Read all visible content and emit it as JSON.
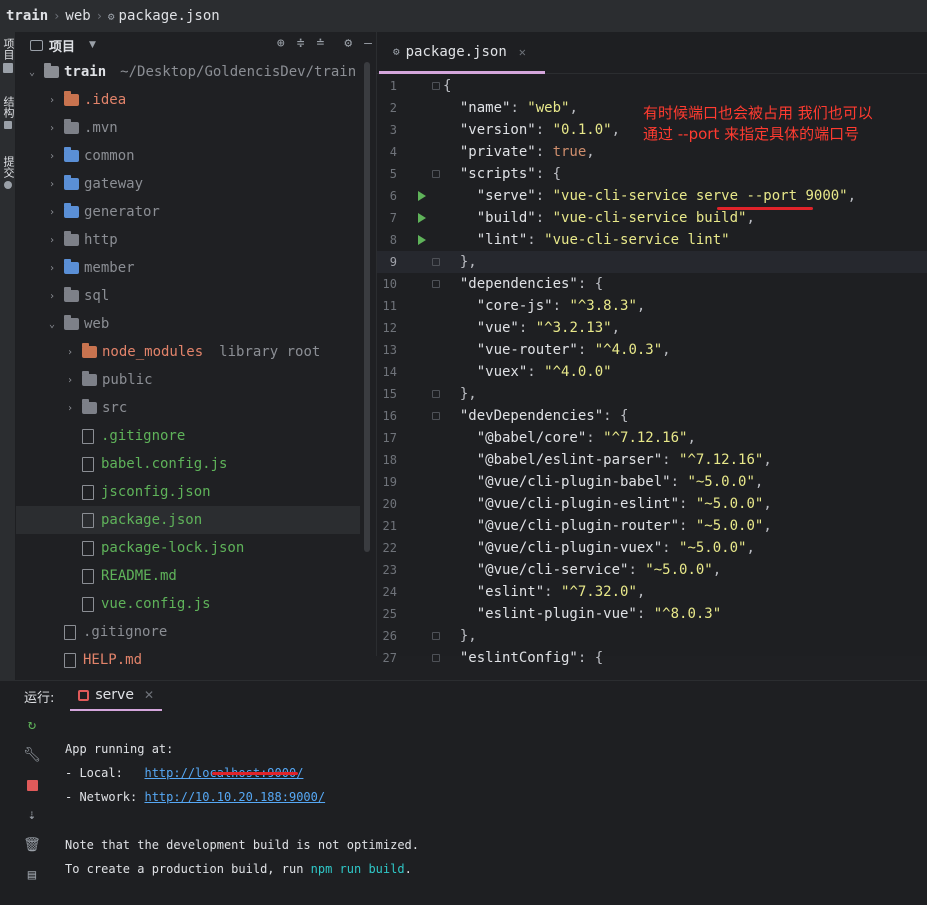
{
  "breadcrumb": {
    "items": [
      "train",
      "web"
    ],
    "file": "package.json"
  },
  "strip": {
    "project": "项目",
    "structure": "结构",
    "commit": "提交"
  },
  "project_panel": {
    "title": "项目",
    "root_name": "train",
    "root_path": "~/Desktop/GoldencisDev/train",
    "items": [
      {
        "label": ".idea",
        "type": "folder",
        "color": "#e2836a"
      },
      {
        "label": ".mvn",
        "type": "folder",
        "color": "#8b8e94"
      },
      {
        "label": "common",
        "type": "module",
        "color": "#8b8e94"
      },
      {
        "label": "gateway",
        "type": "module",
        "color": "#8b8e94"
      },
      {
        "label": "generator",
        "type": "module",
        "color": "#8b8e94"
      },
      {
        "label": "http",
        "type": "folder",
        "color": "#8b8e94"
      },
      {
        "label": "member",
        "type": "module",
        "color": "#8b8e94"
      },
      {
        "label": "sql",
        "type": "folder",
        "color": "#8b8e94"
      },
      {
        "label": "web",
        "type": "folder",
        "color": "#8b8e94"
      },
      {
        "label": "node_modules",
        "type": "folder",
        "color": "#e2836a",
        "suffix": "library root"
      },
      {
        "label": "public",
        "type": "folder",
        "color": "#8b8e94"
      },
      {
        "label": "src",
        "type": "folder",
        "color": "#8b8e94"
      },
      {
        "label": ".gitignore",
        "type": "file",
        "color": "#5fb35a"
      },
      {
        "label": "babel.config.js",
        "type": "file",
        "color": "#5fb35a"
      },
      {
        "label": "jsconfig.json",
        "type": "file",
        "color": "#5fb35a"
      },
      {
        "label": "package.json",
        "type": "file",
        "color": "#5fb35a"
      },
      {
        "label": "package-lock.json",
        "type": "file",
        "color": "#5fb35a"
      },
      {
        "label": "README.md",
        "type": "file",
        "color": "#5fb35a"
      },
      {
        "label": "vue.config.js",
        "type": "file",
        "color": "#5fb35a"
      },
      {
        "label": ".gitignore",
        "type": "file",
        "color": "#8b8e94"
      },
      {
        "label": "HELP.md",
        "type": "file",
        "color": "#e2836a"
      }
    ]
  },
  "editor": {
    "tab": "package.json",
    "lines": [
      {
        "n": "1",
        "t": "{"
      },
      {
        "n": "2",
        "t": "  \"name\": \"web\","
      },
      {
        "n": "3",
        "t": "  \"version\": \"0.1.0\","
      },
      {
        "n": "4",
        "t": "  \"private\": true,"
      },
      {
        "n": "5",
        "t": "  \"scripts\": {"
      },
      {
        "n": "6",
        "t": "    \"serve\": \"vue-cli-service serve --port 9000\","
      },
      {
        "n": "7",
        "t": "    \"build\": \"vue-cli-service build\","
      },
      {
        "n": "8",
        "t": "    \"lint\": \"vue-cli-service lint\""
      },
      {
        "n": "9",
        "t": "  },"
      },
      {
        "n": "10",
        "t": "  \"dependencies\": {"
      },
      {
        "n": "11",
        "t": "    \"core-js\": \"^3.8.3\","
      },
      {
        "n": "12",
        "t": "    \"vue\": \"^3.2.13\","
      },
      {
        "n": "13",
        "t": "    \"vue-router\": \"^4.0.3\","
      },
      {
        "n": "14",
        "t": "    \"vuex\": \"^4.0.0\""
      },
      {
        "n": "15",
        "t": "  },"
      },
      {
        "n": "16",
        "t": "  \"devDependencies\": {"
      },
      {
        "n": "17",
        "t": "    \"@babel/core\": \"^7.12.16\","
      },
      {
        "n": "18",
        "t": "    \"@babel/eslint-parser\": \"^7.12.16\","
      },
      {
        "n": "19",
        "t": "    \"@vue/cli-plugin-babel\": \"~5.0.0\","
      },
      {
        "n": "20",
        "t": "    \"@vue/cli-plugin-eslint\": \"~5.0.0\","
      },
      {
        "n": "21",
        "t": "    \"@vue/cli-plugin-router\": \"~5.0.0\","
      },
      {
        "n": "22",
        "t": "    \"@vue/cli-plugin-vuex\": \"~5.0.0\","
      },
      {
        "n": "23",
        "t": "    \"@vue/cli-service\": \"~5.0.0\","
      },
      {
        "n": "24",
        "t": "    \"eslint\": \"^7.32.0\","
      },
      {
        "n": "25",
        "t": "    \"eslint-plugin-vue\": \"^8.0.3\""
      },
      {
        "n": "26",
        "t": "  },"
      },
      {
        "n": "27",
        "t": "  \"eslintConfig\": {"
      }
    ],
    "annotation_line1": "有时候端口也会被占用 我们也可以",
    "annotation_line2": "通过 --port 来指定具体的端口号"
  },
  "run_panel": {
    "label": "运行:",
    "tab": "serve",
    "console": {
      "l1": "App running at:",
      "local_label": "- Local:   ",
      "local_url": "http://localhost:9000/",
      "network_label": "- Network: ",
      "network_url": "http://10.10.20.188:9000/",
      "note1": "Note that the development build is not optimized.",
      "note2_prefix": "To create a production build, run ",
      "note2_cmd": "npm run build",
      "note2_suffix": "."
    }
  },
  "colors": {
    "accent_tab": "#d4a6dc",
    "annotation": "#ff3b30",
    "link": "#56a8f5"
  }
}
